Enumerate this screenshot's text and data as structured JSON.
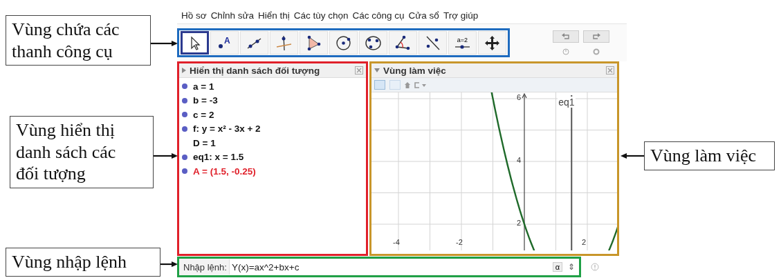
{
  "menu": [
    "Hồ sơ",
    "Chỉnh sửa",
    "Hiển thị",
    "Các tùy chọn",
    "Các công cụ",
    "Cửa sổ",
    "Trợ giúp"
  ],
  "toolbar": {
    "color": "#1e6bbf",
    "tools": [
      {
        "kind": "pointer",
        "selected": true
      },
      {
        "kind": "point",
        "label": "A",
        "selected": false
      },
      {
        "kind": "line",
        "selected": false
      },
      {
        "kind": "perpendicular",
        "selected": false
      },
      {
        "kind": "polygon",
        "selected": false
      },
      {
        "kind": "circle",
        "selected": false
      },
      {
        "kind": "circle3",
        "selected": false
      },
      {
        "kind": "angle",
        "selected": false
      },
      {
        "kind": "reflect",
        "selected": false
      },
      {
        "kind": "slider",
        "label": "a=2",
        "selected": false
      },
      {
        "kind": "move",
        "selected": false
      }
    ]
  },
  "algebra": {
    "color": "#e0202a",
    "title": "Hiển thị danh sách đối tượng",
    "items": [
      {
        "text": "a = 1",
        "shown": true,
        "color": "#111111"
      },
      {
        "text": "b = -3",
        "shown": true,
        "color": "#111111"
      },
      {
        "text": "c = 2",
        "shown": true,
        "color": "#111111"
      },
      {
        "text": "f: y = x² - 3x + 2",
        "shown": true,
        "color": "#111111"
      },
      {
        "text": "D = 1",
        "shown": false,
        "color": "#111111"
      },
      {
        "text": "eq1: x = 1.5",
        "shown": true,
        "color": "#111111"
      },
      {
        "text": "A = (1.5, -0.25)",
        "shown": true,
        "color": "#e0202a"
      }
    ]
  },
  "graphics": {
    "color": "#c8962a",
    "title": "Vùng làm việc",
    "x_labels": [
      "-4",
      "-2",
      "2"
    ],
    "y_labels": [
      "6",
      "4",
      "2"
    ],
    "line_label": "eq1"
  },
  "input": {
    "color": "#1fa046",
    "label": "Nhập lệnh:",
    "value": "Y(x)=ax^2+bx+c",
    "symbol": "α",
    "spinner": "⇕"
  },
  "callouts": [
    {
      "text": "Vùng chứa các\nthanh công cụ"
    },
    {
      "text": "Vùng hiển thị\ndanh sách các\nđối tượng"
    },
    {
      "text": "Vùng nhập lệnh"
    },
    {
      "text": "Vùng làm việc"
    }
  ]
}
